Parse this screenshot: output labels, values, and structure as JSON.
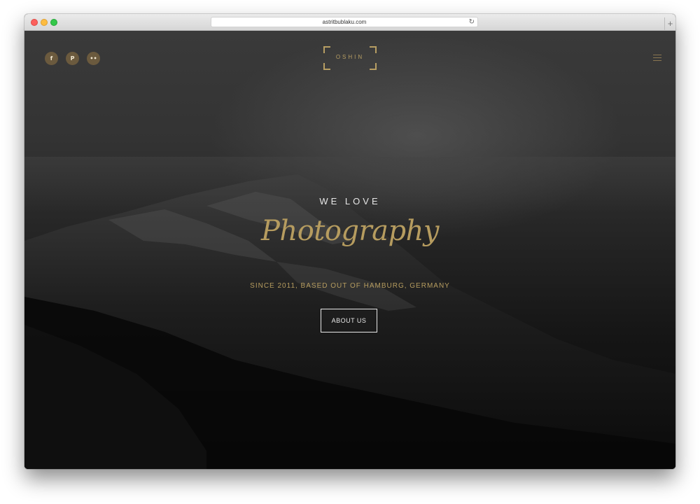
{
  "browser": {
    "url": "astritbublaku.com",
    "reload_icon": "↻",
    "new_tab_icon": "+"
  },
  "header": {
    "social": [
      {
        "icon": "facebook-icon",
        "glyph": "f"
      },
      {
        "icon": "pinterest-icon",
        "glyph": "P"
      },
      {
        "icon": "flickr-icon",
        "glyph": "••"
      }
    ],
    "logo": "OSHIN",
    "menu_icon": "hamburger-menu-icon"
  },
  "hero": {
    "tagline": "WE LOVE",
    "headline": "Photography",
    "subline": "SINCE 2011, BASED OUT OF HAMBURG, GERMANY",
    "cta_label": "ABOUT US"
  },
  "colors": {
    "accent_gold": "#b69c5f",
    "social_bg": "#6b5a3e",
    "background_dark": "#0c0c0c"
  }
}
